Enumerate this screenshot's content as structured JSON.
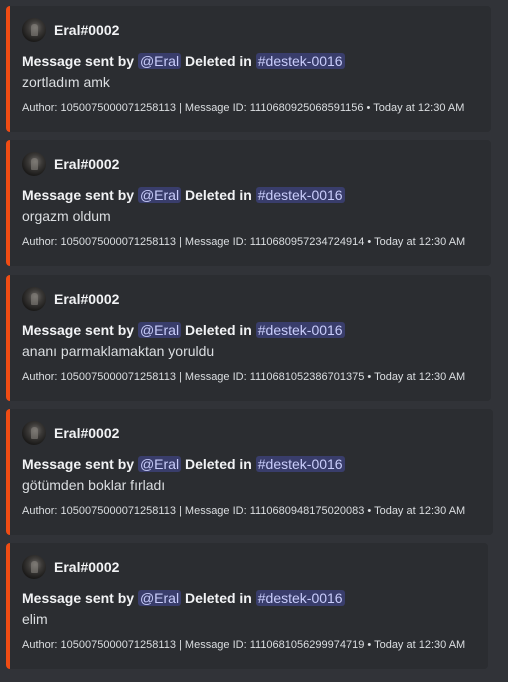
{
  "accent_color": "#f04c14",
  "embeds": [
    {
      "author": "Eral#0002",
      "title_prefix": "Message sent by",
      "mention": "@Eral",
      "title_middle": "Deleted in",
      "channel": "#destek-0016",
      "content": "zortladım amk",
      "footer": "Author: 1050075000071258113 | Message ID: 1110680925068591156 • Today at 12:30 AM"
    },
    {
      "author": "Eral#0002",
      "title_prefix": "Message sent by",
      "mention": "@Eral",
      "title_middle": "Deleted in",
      "channel": "#destek-0016",
      "content": "orgazm oldum",
      "footer": "Author: 1050075000071258113 | Message ID: 1110680957234724914 • Today at 12:30 AM"
    },
    {
      "author": "Eral#0002",
      "title_prefix": "Message sent by",
      "mention": "@Eral",
      "title_middle": "Deleted in",
      "channel": "#destek-0016",
      "content": "ananı parmaklamaktan yoruldu",
      "footer": "Author: 1050075000071258113 | Message ID: 1110681052386701375 • Today at 12:30 AM"
    },
    {
      "author": "Eral#0002",
      "title_prefix": "Message sent by",
      "mention": "@Eral",
      "title_middle": "Deleted in",
      "channel": "#destek-0016",
      "content": "götümden boklar fırladı",
      "footer": "Author: 1050075000071258113 | Message ID: 1110680948175020083 • Today at 12:30 AM"
    },
    {
      "author": "Eral#0002",
      "title_prefix": "Message sent by",
      "mention": "@Eral",
      "title_middle": "Deleted in",
      "channel": "#destek-0016",
      "content": "elim",
      "footer": "Author: 1050075000071258113 | Message ID: 1110681056299974719 • Today at 12:30 AM"
    }
  ]
}
